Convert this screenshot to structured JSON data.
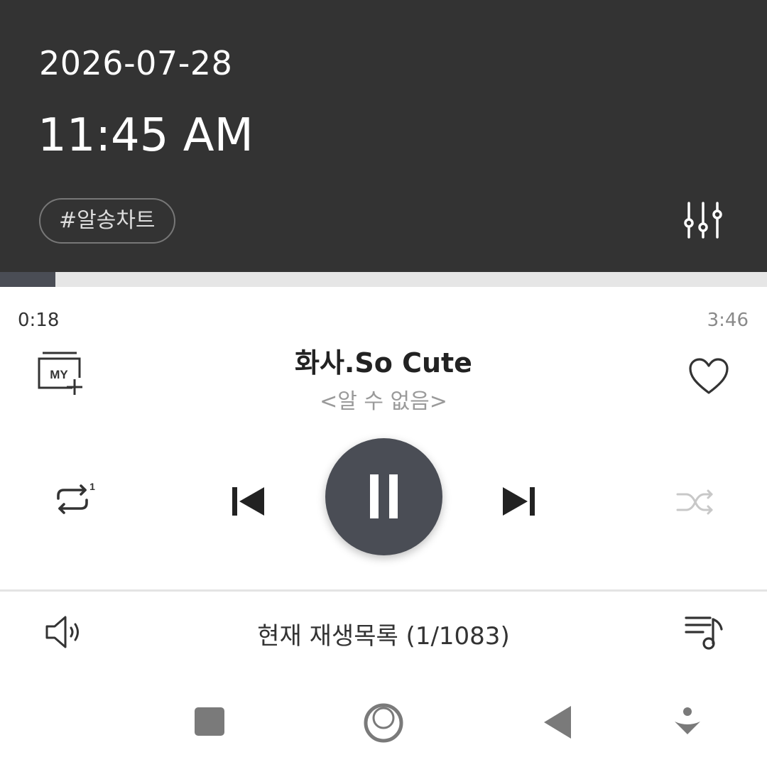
{
  "header": {
    "date": "2026-07-28",
    "time": "11:45 AM",
    "tag": "#알송차트",
    "equalizer_icon": "equalizer-icon"
  },
  "progress": {
    "elapsed": "0:18",
    "total": "3:46",
    "fraction": 0.072
  },
  "track": {
    "title": "화사.So Cute",
    "artist": "<알 수 없음>",
    "my_badge": "MY"
  },
  "controls": {
    "repeat_count": "1",
    "icons": [
      "my-playlist-add-icon",
      "heart-icon",
      "repeat-one-icon",
      "previous-icon",
      "pause-icon",
      "next-icon",
      "shuffle-icon"
    ]
  },
  "bottom": {
    "playlist_label": "현재 재생목록 (1/1083)",
    "icons": [
      "volume-icon",
      "queue-icon"
    ]
  },
  "system_nav": {
    "icons": [
      "recents-icon",
      "home-icon",
      "back-icon",
      "notification-down-icon"
    ]
  },
  "colors": {
    "header_bg": "#333333",
    "accent": "#4a4d55",
    "progress_track": "#e6e6e6",
    "shuffle_disabled": "#c8c8c8"
  }
}
